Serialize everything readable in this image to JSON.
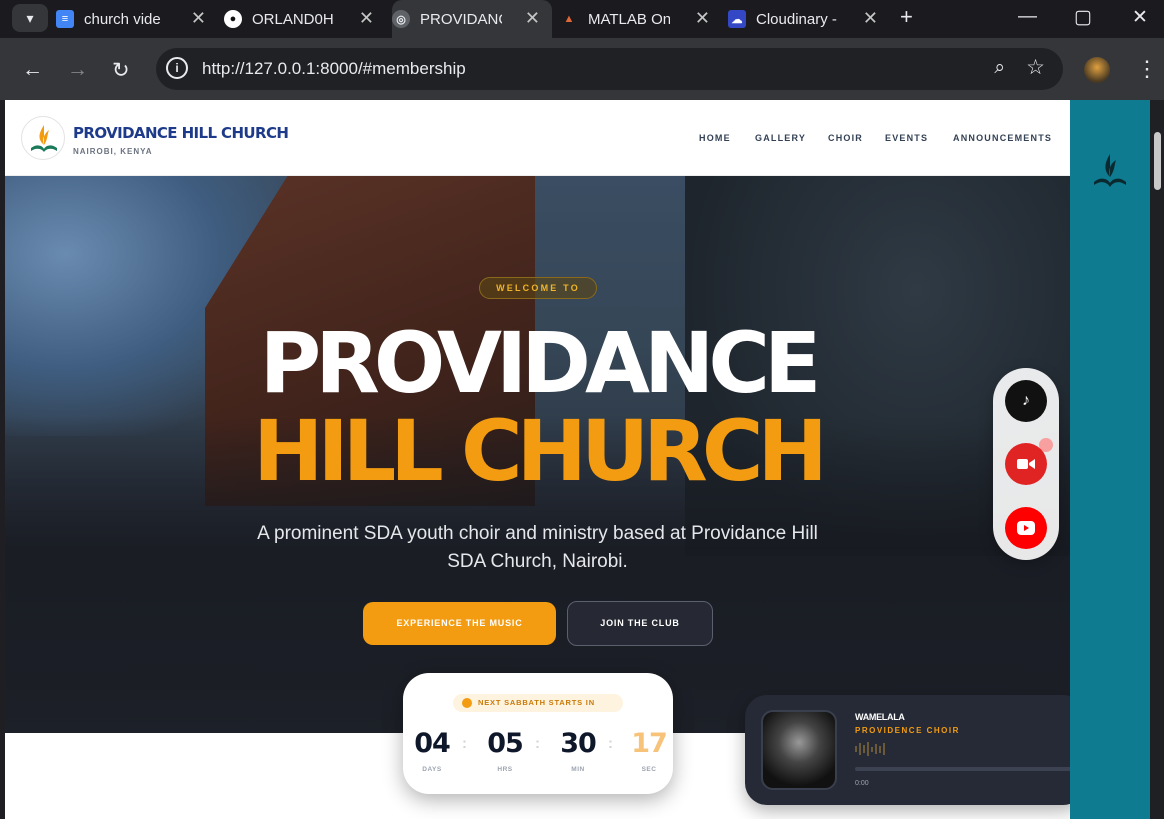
{
  "browser": {
    "tabs": [
      {
        "title": "church vide",
        "icon": "docs-icon",
        "color": "#4285f4"
      },
      {
        "title": "ORLAND0H",
        "icon": "github-icon",
        "color": "#ffffff"
      },
      {
        "title": "PROVIDANC",
        "icon": "globe-icon",
        "color": "#c4c7c5",
        "active": true
      },
      {
        "title": "MATLAB On",
        "icon": "matlab-icon",
        "color": "#e16737"
      },
      {
        "title": "Cloudinary -",
        "icon": "cloudinary-icon",
        "color": "#3448c5"
      }
    ],
    "url": "http://127.0.0.1:8000/#membership"
  },
  "site": {
    "brand": "PROVIDANCE HILL CHURCH",
    "location": "NAIROBI, KENYA",
    "nav": [
      "HOME",
      "GALLERY",
      "CHOIR",
      "EVENTS",
      "ANNOUNCEMENTS"
    ]
  },
  "hero": {
    "badge": "WELCOME TO",
    "title_line1": "PROVIDANCE",
    "title_line2": "HILL CHURCH",
    "subtitle": "A prominent SDA youth choir and ministry based at Providance Hill SDA Church, Nairobi.",
    "cta_primary": "EXPERIENCE THE MUSIC",
    "cta_secondary": "JOIN THE CLUB"
  },
  "countdown": {
    "label": "NEXT SABBATH STARTS IN",
    "days": "04",
    "hours": "05",
    "minutes": "30",
    "seconds": "17",
    "days_label": "DAYS",
    "hours_label": "HRS",
    "minutes_label": "MIN",
    "seconds_label": "SEC"
  },
  "player": {
    "track": "WAMELALA",
    "artist": "PROVIDENCE CHOIR",
    "time": "0:00",
    "progress": 0
  },
  "social": [
    {
      "name": "tiktok-icon",
      "color": "#111111"
    },
    {
      "name": "video-camera-icon",
      "color": "#e02424"
    },
    {
      "name": "youtube-icon",
      "color": "#ff0000"
    }
  ],
  "colors": {
    "accent": "#f39c12",
    "brand": "#1e3a8a",
    "sidebar": "#0e7b91"
  }
}
